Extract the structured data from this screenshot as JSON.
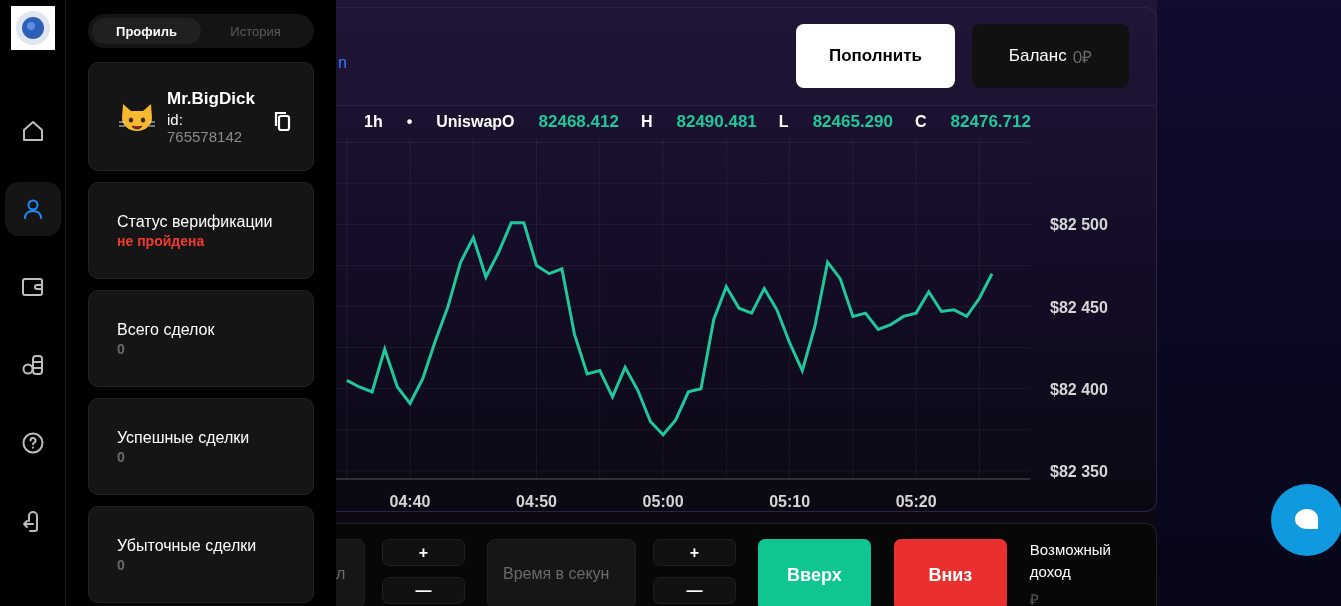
{
  "nav": [
    {
      "selected": false
    },
    {
      "selected": true
    },
    {
      "selected": false
    },
    {
      "selected": false
    },
    {
      "selected": false
    },
    {
      "selected": false
    }
  ],
  "panel_tabs": [
    {
      "label": "Профиль",
      "selected": true
    },
    {
      "label": "История",
      "selected": false
    }
  ],
  "profile": {
    "name": "Mr.BigDick",
    "id_label": "id:",
    "id_value": "765578142"
  },
  "stats": [
    {
      "kind": "status",
      "label": "Статус верификации",
      "value": "не пройдена"
    },
    {
      "kind": "count",
      "label": "Всего сделок",
      "value": "0"
    },
    {
      "kind": "count",
      "label": "Успешные сделки",
      "value": "0"
    },
    {
      "kind": "count",
      "label": "Убыточные сделки",
      "value": "0"
    }
  ],
  "header": {
    "link": "n",
    "deposit_button": "Пополнить",
    "balance_label": "Баланс",
    "balance_value": "0₽"
  },
  "ohlc": {
    "interval": "1h",
    "separator": "•",
    "source": "Uniswap",
    "fields": [
      {
        "label": "O",
        "value": "82468.412"
      },
      {
        "label": "H",
        "value": "82490.481"
      },
      {
        "label": "L",
        "value": "82465.290"
      },
      {
        "label": "C",
        "value": "82476.712"
      }
    ]
  },
  "chart": {
    "chart_data": {
      "type": "line",
      "grid": true,
      "ylim": [
        82345,
        82552
      ],
      "categories": [
        null,
        null,
        null,
        null,
        null,
        "04:40",
        null,
        null,
        null,
        null,
        null,
        null,
        null,
        null,
        null,
        "04:50",
        null,
        null,
        null,
        null,
        null,
        null,
        null,
        null,
        null,
        "05:00",
        null,
        null,
        null,
        null,
        null,
        null,
        null,
        null,
        null,
        "05:10",
        null,
        null,
        null,
        null,
        null,
        null,
        null,
        null,
        null,
        "05:20",
        null,
        null,
        null,
        null,
        null,
        null
      ],
      "yticks": [
        {
          "value": 82500,
          "label": "$82 500"
        },
        {
          "value": 82450,
          "label": "$82 450"
        },
        {
          "value": 82400,
          "label": "$82 400"
        },
        {
          "value": 82350,
          "label": "$82 350"
        }
      ],
      "series": [
        {
          "color": "#1fc79a",
          "values": [
            82405,
            82401,
            82398,
            82424,
            82401,
            82391,
            82406,
            82429,
            82450,
            82477,
            82492,
            82468,
            82483,
            82501,
            82501,
            82475,
            82470,
            82473,
            82433,
            82409,
            82411,
            82395,
            82413,
            82399,
            82380,
            82372,
            82381,
            82398,
            82400,
            82442,
            82462,
            82449,
            82446,
            82461,
            82448,
            82428,
            82411,
            82438,
            82477,
            82467,
            82444,
            82446,
            82436,
            82439,
            82444,
            82446,
            82459,
            82447,
            82448,
            82444,
            82455,
            82470
          ]
        }
      ]
    }
  },
  "trade": {
    "amount_placeholder": "л",
    "steppers": [
      {
        "plus": "+",
        "minus": "—"
      },
      {
        "plus": "+",
        "minus": "—"
      }
    ],
    "time_placeholder": "Время в секун",
    "up_button": "Вверх",
    "down_button": "Вниз",
    "income_label": "Возможный доход",
    "income_value": "₽"
  }
}
